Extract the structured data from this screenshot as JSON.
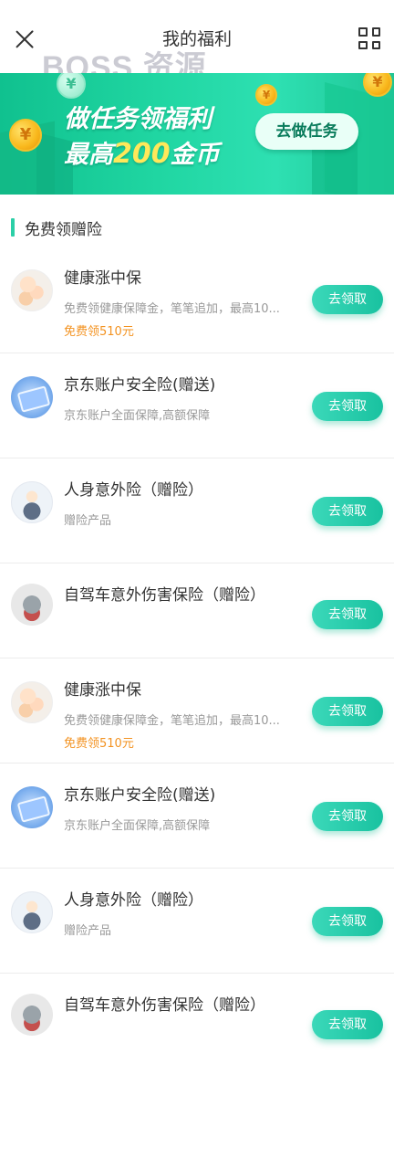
{
  "header": {
    "title": "我的福利",
    "watermark": "BOSS 资源"
  },
  "banner": {
    "line1": "做任务领福利",
    "line2_prefix": "最高",
    "line2_amount": "200",
    "line2_suffix": "金币",
    "button_label": "去做任务",
    "coin_symbol": "¥"
  },
  "section": {
    "title": "免费领赠险",
    "accent_color": "#2ccfa7"
  },
  "items": [
    {
      "title": "健康涨中保",
      "desc": "免费领健康保障金，笔笔追加，最高10...",
      "promo": "免费领510元",
      "button": "去领取",
      "icon": "family-icon"
    },
    {
      "title": "京东账户安全险(赠送)",
      "desc": "京东账户全面保障,高额保障",
      "promo": "",
      "button": "去领取",
      "icon": "card-icon"
    },
    {
      "title": "人身意外险（赠险）",
      "desc": "赠险产品",
      "promo": "",
      "button": "去领取",
      "icon": "person-icon"
    },
    {
      "title": "自驾车意外伤害保险（赠险）",
      "desc": "",
      "promo": "",
      "button": "去领取",
      "icon": "car-icon"
    },
    {
      "title": "健康涨中保",
      "desc": "免费领健康保障金，笔笔追加，最高10...",
      "promo": "免费领510元",
      "button": "去领取",
      "icon": "family-icon"
    },
    {
      "title": "京东账户安全险(赠送)",
      "desc": "京东账户全面保障,高额保障",
      "promo": "",
      "button": "去领取",
      "icon": "card-icon"
    },
    {
      "title": "人身意外险（赠险）",
      "desc": "赠险产品",
      "promo": "",
      "button": "去领取",
      "icon": "person-icon"
    },
    {
      "title": "自驾车意外伤害保险（赠险）",
      "desc": "",
      "promo": "",
      "button": "去领取",
      "icon": "car-icon"
    }
  ],
  "colors": {
    "button_gradient_start": "#3bd8b9",
    "button_gradient_end": "#19c2a0",
    "promo": "#f39322",
    "banner_green": "#20d6a2"
  }
}
